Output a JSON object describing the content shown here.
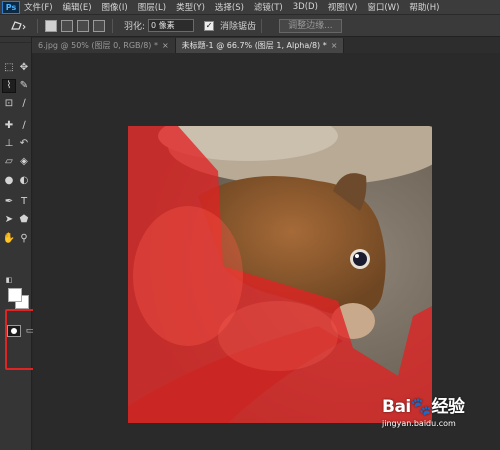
{
  "app": {
    "logo": "Ps"
  },
  "menu": [
    "文件(F)",
    "编辑(E)",
    "图像(I)",
    "图层(L)",
    "类型(Y)",
    "选择(S)",
    "滤镜(T)",
    "3D(D)",
    "视图(V)",
    "窗口(W)",
    "帮助(H)"
  ],
  "options": {
    "tool_preset_icon": "polygonal-lasso-icon",
    "feather_label": "羽化:",
    "feather_value": "0 像素",
    "antialias_label": "消除锯齿",
    "antialias_checked": true,
    "refine_edge_label": "调整边缘..."
  },
  "tabs": [
    {
      "label": "6.jpg @ 50% (图层 0, RGB/8) *",
      "active": false,
      "close": "×"
    },
    {
      "label": "未标题-1 @ 66.7% (图层 1, Alpha/8) *",
      "active": true,
      "close": "×"
    }
  ],
  "tools": [
    {
      "name": "marquee",
      "glyph": "⬚"
    },
    {
      "name": "move",
      "glyph": "✥"
    },
    {
      "name": "polygonal-lasso",
      "glyph": "⌇"
    },
    {
      "name": "quick-selection",
      "glyph": "✎"
    },
    {
      "name": "crop",
      "glyph": "⊡"
    },
    {
      "name": "eyedropper",
      "glyph": "∕"
    },
    {
      "name": "spot-healing",
      "glyph": "✚"
    },
    {
      "name": "brush",
      "glyph": "∕"
    },
    {
      "name": "clone-stamp",
      "glyph": "⊥"
    },
    {
      "name": "history-brush",
      "glyph": "↶"
    },
    {
      "name": "eraser",
      "glyph": "▱"
    },
    {
      "name": "paint-bucket",
      "glyph": "◈"
    },
    {
      "name": "blur",
      "glyph": "●"
    },
    {
      "name": "dodge",
      "glyph": "◐"
    },
    {
      "name": "pen",
      "glyph": "✒"
    },
    {
      "name": "type",
      "glyph": "T"
    },
    {
      "name": "path-selection",
      "glyph": "➤"
    },
    {
      "name": "shape",
      "glyph": "⬟"
    },
    {
      "name": "hand",
      "glyph": "✋"
    },
    {
      "name": "zoom",
      "glyph": "⚲"
    }
  ],
  "colors": {
    "foreground": "#ffffff",
    "background": "#ffffff",
    "quickmask_overlay": "#e02323"
  },
  "watermark": {
    "brand": "Bai",
    "brand2": "经验",
    "url": "jingyan.baidu.com"
  }
}
